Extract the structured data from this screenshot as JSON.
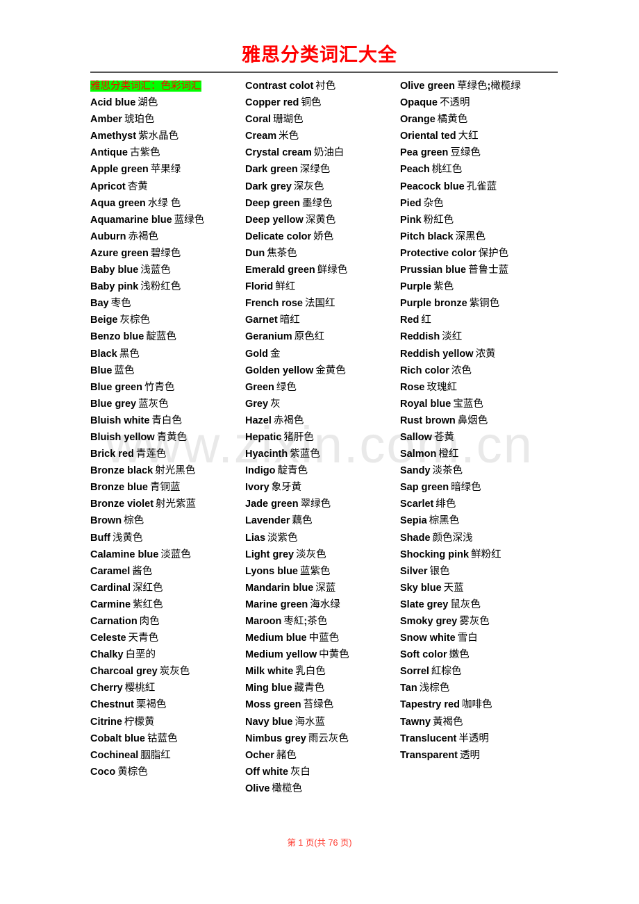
{
  "document": {
    "title": "雅思分类词汇大全",
    "title_color": "#ff0000",
    "section_heading": "雅思分类词汇：色彩词汇",
    "section_heading_color": "#ff0000",
    "section_heading_highlight": "#00ff00",
    "watermark": "www.zixin.com.cn",
    "footer": "第 1 页(共 76 页)",
    "footer_color": "#ff3b30",
    "page_number": 1,
    "total_pages": 76
  },
  "columns": [
    {
      "id": "column-1",
      "entries": [
        {
          "term": "Acid blue",
          "gloss": "湖色"
        },
        {
          "term": "Amber",
          "gloss": "琥珀色"
        },
        {
          "term": "Amethyst",
          "gloss": "紫水晶色"
        },
        {
          "term": "Antique",
          "gloss": "古紫色"
        },
        {
          "term": "Apple green",
          "gloss": "苹果绿"
        },
        {
          "term": "Apricot",
          "gloss": "杏黄"
        },
        {
          "term": "Aqua green",
          "gloss": "水绿 色"
        },
        {
          "term": "Aquamarine blue",
          "gloss": "蓝绿色"
        },
        {
          "term": "Auburn",
          "gloss": "赤褐色"
        },
        {
          "term": "Azure green",
          "gloss": "碧绿色"
        },
        {
          "term": "Baby blue",
          "gloss": "浅蓝色"
        },
        {
          "term": "Baby pink",
          "gloss": "浅粉红色"
        },
        {
          "term": "Bay",
          "gloss": "枣色"
        },
        {
          "term": "Beige",
          "gloss": "灰棕色"
        },
        {
          "term": "Benzo blue",
          "gloss": "靛蓝色"
        },
        {
          "term": "Black",
          "gloss": "黑色"
        },
        {
          "term": "Blue",
          "gloss": "蓝色"
        },
        {
          "term": "Blue green",
          "gloss": "竹青色"
        },
        {
          "term": "Blue grey",
          "gloss": "蓝灰色"
        },
        {
          "term": "Bluish white",
          "gloss": "青白色"
        },
        {
          "term": "Bluish yellow",
          "gloss": "青黄色"
        },
        {
          "term": "Brick red",
          "gloss": "青莲色"
        },
        {
          "term": "Bronze black",
          "gloss": "射光黑色"
        },
        {
          "term": "Bronze blue",
          "gloss": "青铜蓝"
        },
        {
          "term": "Bronze violet",
          "gloss": "射光紫蓝"
        },
        {
          "term": "Brown",
          "gloss": "棕色"
        },
        {
          "term": "Buff",
          "gloss": "浅黄色"
        },
        {
          "term": "Calamine blue",
          "gloss": "淡蓝色"
        },
        {
          "term": "Caramel",
          "gloss": "酱色"
        },
        {
          "term": "Cardinal",
          "gloss": "深红色"
        },
        {
          "term": "Carmine",
          "gloss": "紫红色"
        },
        {
          "term": "Carnation",
          "gloss": "肉色"
        },
        {
          "term": "Celeste",
          "gloss": "天青色"
        },
        {
          "term": "Chalky",
          "gloss": "白垩的"
        },
        {
          "term": "Charcoal grey",
          "gloss": "炭灰色"
        },
        {
          "term": "Cherry",
          "gloss": "樱桃紅"
        },
        {
          "term": "Chestnut",
          "gloss": "栗褐色"
        },
        {
          "term": "Citrine",
          "gloss": "柠檬黄"
        },
        {
          "term": "Cobalt blue",
          "gloss": "钴蓝色"
        },
        {
          "term": "Cochineal",
          "gloss": "胭脂红"
        },
        {
          "term": "Coco",
          "gloss": "黄棕色"
        }
      ]
    },
    {
      "id": "column-2",
      "entries": [
        {
          "term": "Contrast colot",
          "gloss": "衬色"
        },
        {
          "term": "Copper red",
          "gloss": "铜色"
        },
        {
          "term": "Coral",
          "gloss": "珊瑚色"
        },
        {
          "term": "Cream",
          "gloss": "米色"
        },
        {
          "term": "Crystal cream",
          "gloss": "奶油白"
        },
        {
          "term": "Dark green",
          "gloss": "深绿色"
        },
        {
          "term": "Dark grey",
          "gloss": "深灰色"
        },
        {
          "term": "Deep green",
          "gloss": "墨绿色"
        },
        {
          "term": "Deep yellow",
          "gloss": "深黄色"
        },
        {
          "term": "Delicate color",
          "gloss": "娇色"
        },
        {
          "term": "Dun",
          "gloss": "焦茶色"
        },
        {
          "term": "Emerald green",
          "gloss": "鲜绿色"
        },
        {
          "term": "Florid",
          "gloss": "鲜红"
        },
        {
          "term": "French rose",
          "gloss": "法国红"
        },
        {
          "term": "Garnet",
          "gloss": "暗红"
        },
        {
          "term": "Geranium",
          "gloss": "原色红"
        },
        {
          "term": "Gold",
          "gloss": "金"
        },
        {
          "term": "Golden yellow",
          "gloss": "金黄色"
        },
        {
          "term": "Green",
          "gloss": "绿色"
        },
        {
          "term": "Grey",
          "gloss": "灰"
        },
        {
          "term": "Hazel",
          "gloss": "赤褐色"
        },
        {
          "term": "Hepatic",
          "gloss": "猪肝色"
        },
        {
          "term": "Hyacinth",
          "gloss": "紫蓝色"
        },
        {
          "term": "Indigo",
          "gloss": "靛青色"
        },
        {
          "term": "Ivory",
          "gloss": "象牙黄"
        },
        {
          "term": "Jade green",
          "gloss": "翠绿色"
        },
        {
          "term": "Lavender",
          "gloss": "藕色"
        },
        {
          "term": "Lias",
          "gloss": "淡紫色"
        },
        {
          "term": "Light grey",
          "gloss": "淡灰色"
        },
        {
          "term": "Lyons blue",
          "gloss": "蓝紫色"
        },
        {
          "term": "Mandarin blue",
          "gloss": "深蓝"
        },
        {
          "term": "Marine green",
          "gloss": "海水绿"
        },
        {
          "term": "Maroon",
          "gloss": "枣紅;茶色",
          "sep": ";"
        },
        {
          "term": "Medium blue",
          "gloss": "中蓝色"
        },
        {
          "term": "Medium yellow",
          "gloss": "中黄色"
        },
        {
          "term": "Milk white",
          "gloss": "乳白色"
        },
        {
          "term": "Ming blue",
          "gloss": "藏青色"
        },
        {
          "term": "Moss green",
          "gloss": "苔绿色"
        },
        {
          "term": "Navy blue",
          "gloss": "海水蓝"
        },
        {
          "term": "Nimbus grey",
          "gloss": "雨云灰色"
        },
        {
          "term": "Ocher",
          "gloss": "赭色"
        },
        {
          "term": "Off white",
          "gloss": "灰白"
        },
        {
          "term": "Olive",
          "gloss": "橄榄色"
        }
      ]
    },
    {
      "id": "column-3",
      "entries": [
        {
          "term": "Olive green",
          "gloss": "草绿色;橄榄绿",
          "sep": ";"
        },
        {
          "term": "Opaque",
          "gloss": "不透明"
        },
        {
          "term": "Orange",
          "gloss": "橘黄色"
        },
        {
          "term": "Oriental ted",
          "gloss": "大红"
        },
        {
          "term": "Pea green",
          "gloss": "豆绿色"
        },
        {
          "term": "Peach",
          "gloss": "桃红色"
        },
        {
          "term": "Peacock blue",
          "gloss": "孔雀蓝"
        },
        {
          "term": "Pied",
          "gloss": "杂色"
        },
        {
          "term": "Pink",
          "gloss": "粉紅色"
        },
        {
          "term": "Pitch black",
          "gloss": "深黑色"
        },
        {
          "term": "Protective color",
          "gloss": "保护色"
        },
        {
          "term": "Prussian blue",
          "gloss": "普鲁士蓝"
        },
        {
          "term": "Purple",
          "gloss": "紫色"
        },
        {
          "term": "Purple bronze",
          "gloss": "紫铜色"
        },
        {
          "term": "Red",
          "gloss": "红"
        },
        {
          "term": "Reddish",
          "gloss": "淡红"
        },
        {
          "term": "Reddish yellow",
          "gloss": "浓黄"
        },
        {
          "term": "Rich color",
          "gloss": "浓色"
        },
        {
          "term": "Rose",
          "gloss": "玫瑰紅"
        },
        {
          "term": "Royal blue",
          "gloss": "宝蓝色"
        },
        {
          "term": "Rust brown",
          "gloss": "鼻烟色"
        },
        {
          "term": "Sallow",
          "gloss": "苍黄"
        },
        {
          "term": "Salmon",
          "gloss": "橙红"
        },
        {
          "term": "Sandy",
          "gloss": "淡茶色"
        },
        {
          "term": "Sap green",
          "gloss": "暗绿色"
        },
        {
          "term": "Scarlet",
          "gloss": "绯色"
        },
        {
          "term": "Sepia",
          "gloss": "棕黑色"
        },
        {
          "term": "Shade",
          "gloss": "颜色深浅"
        },
        {
          "term": "Shocking pink",
          "gloss": "鲜粉红"
        },
        {
          "term": "Silver",
          "gloss": "银色"
        },
        {
          "term": "Sky blue",
          "gloss": "天蓝"
        },
        {
          "term": "Slate grey",
          "gloss": "鼠灰色"
        },
        {
          "term": "Smoky grey",
          "gloss": "雾灰色"
        },
        {
          "term": "Snow white",
          "gloss": "雪白"
        },
        {
          "term": "Soft color",
          "gloss": "嫩色"
        },
        {
          "term": "Sorrel",
          "gloss": "紅棕色"
        },
        {
          "term": "Tan",
          "gloss": "浅棕色"
        },
        {
          "term": "Tapestry red",
          "gloss": "咖啡色"
        },
        {
          "term": "Tawny",
          "gloss": "黃褐色"
        },
        {
          "term": "Translucent",
          "gloss": "半透明"
        },
        {
          "term": "Transparent",
          "gloss": "透明"
        }
      ]
    }
  ]
}
